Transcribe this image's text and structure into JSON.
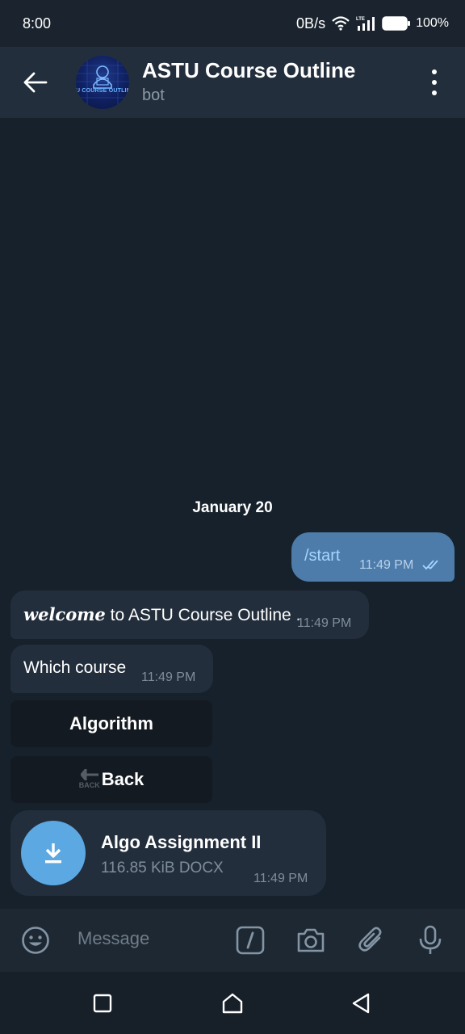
{
  "status_bar": {
    "time": "8:00",
    "network_speed": "0B/s",
    "network_type": "LTE",
    "battery_percent": "100%"
  },
  "header": {
    "title": "ASTU Course Outline",
    "subtitle": "bot",
    "avatar_text": "U COURSE OUTLINE E"
  },
  "chat": {
    "date": "January 20",
    "messages": [
      {
        "direction": "out",
        "text": "/start",
        "time": "11:49 PM",
        "status": "read"
      },
      {
        "direction": "in",
        "text_styled": "welcome",
        "text": " to ASTU Course Outline .",
        "time": "11:49 PM"
      },
      {
        "direction": "in",
        "text": "Which course",
        "time": "11:49 PM"
      }
    ],
    "keyboard": [
      {
        "label": "Algorithm"
      },
      {
        "label": "Back",
        "emoji_text": "BACK"
      }
    ],
    "document": {
      "name": "Algo Assignment II",
      "info": "116.85 KiB DOCX",
      "time": "11:49 PM"
    }
  },
  "input_bar": {
    "placeholder": "Message"
  },
  "colors": {
    "background": "#17212b",
    "header": "#232e3c",
    "outgoing_bubble": "#4d7cab",
    "incoming_bubble": "#232e3c",
    "accent": "#5ca8e3"
  },
  "icons": {
    "back": "arrow-left-icon",
    "menu": "more-vertical-icon",
    "emoji": "smile-icon",
    "commands": "slash-command-icon",
    "camera": "camera-icon",
    "attach": "paperclip-icon",
    "mic": "microphone-icon",
    "download": "download-icon"
  }
}
